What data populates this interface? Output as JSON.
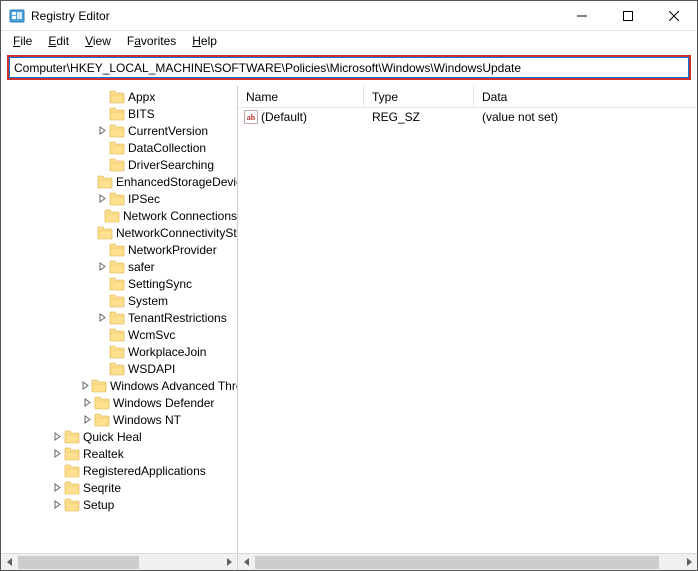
{
  "window": {
    "title": "Registry Editor"
  },
  "menu": {
    "file": "File",
    "edit": "Edit",
    "view": "View",
    "favorites": "Favorites",
    "help": "Help"
  },
  "address": {
    "value": "Computer\\HKEY_LOCAL_MACHINE\\SOFTWARE\\Policies\\Microsoft\\Windows\\WindowsUpdate"
  },
  "tree": {
    "items": [
      {
        "indent": 7,
        "expander": "none",
        "label": "Appx"
      },
      {
        "indent": 7,
        "expander": "none",
        "label": "BITS"
      },
      {
        "indent": 7,
        "expander": "right",
        "label": "CurrentVersion"
      },
      {
        "indent": 7,
        "expander": "none",
        "label": "DataCollection"
      },
      {
        "indent": 7,
        "expander": "none",
        "label": "DriverSearching"
      },
      {
        "indent": 7,
        "expander": "none",
        "label": "EnhancedStorageDevices"
      },
      {
        "indent": 7,
        "expander": "right",
        "label": "IPSec"
      },
      {
        "indent": 7,
        "expander": "none",
        "label": "Network Connections"
      },
      {
        "indent": 7,
        "expander": "none",
        "label": "NetworkConnectivityStatusIndicator"
      },
      {
        "indent": 7,
        "expander": "none",
        "label": "NetworkProvider"
      },
      {
        "indent": 7,
        "expander": "right",
        "label": "safer"
      },
      {
        "indent": 7,
        "expander": "none",
        "label": "SettingSync"
      },
      {
        "indent": 7,
        "expander": "none",
        "label": "System"
      },
      {
        "indent": 7,
        "expander": "right",
        "label": "TenantRestrictions"
      },
      {
        "indent": 7,
        "expander": "none",
        "label": "WcmSvc"
      },
      {
        "indent": 7,
        "expander": "none",
        "label": "WorkplaceJoin"
      },
      {
        "indent": 7,
        "expander": "none",
        "label": "WSDAPI"
      },
      {
        "indent": 6,
        "expander": "right",
        "label": "Windows Advanced Threat Protection"
      },
      {
        "indent": 6,
        "expander": "right",
        "label": "Windows Defender"
      },
      {
        "indent": 6,
        "expander": "right",
        "label": "Windows NT"
      },
      {
        "indent": 4,
        "expander": "right",
        "label": "Quick Heal"
      },
      {
        "indent": 4,
        "expander": "right",
        "label": "Realtek"
      },
      {
        "indent": 4,
        "expander": "none",
        "label": "RegisteredApplications"
      },
      {
        "indent": 4,
        "expander": "right",
        "label": "Seqrite"
      },
      {
        "indent": 4,
        "expander": "right",
        "label": "Setup"
      }
    ]
  },
  "columns": {
    "name": "Name",
    "type": "Type",
    "data": "Data"
  },
  "values": [
    {
      "name": "(Default)",
      "type": "REG_SZ",
      "data": "(value not set)"
    }
  ]
}
